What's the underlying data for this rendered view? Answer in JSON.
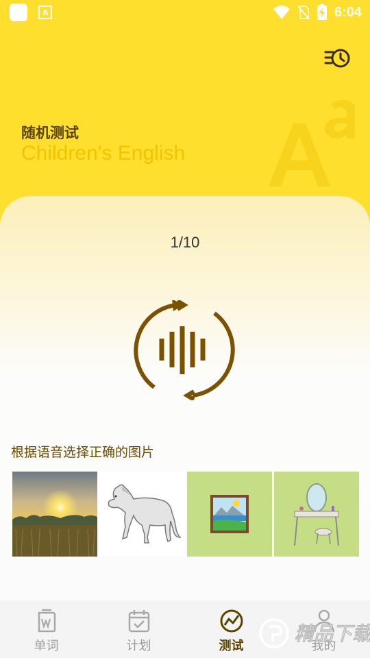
{
  "status_bar": {
    "time": "6:04",
    "icons": [
      "app-icon",
      "a-notification-icon",
      "wifi-icon",
      "no-sim-icon",
      "battery-charging-icon"
    ]
  },
  "header": {
    "title_cn": "随机测试",
    "title_en": "Children's English",
    "history_icon": "history-list-icon",
    "background_color": "#ffdf2e"
  },
  "quiz": {
    "progress": "1/10",
    "audio_icon": "replay-audio-icon",
    "question": "根据语音选择正确的图片",
    "options": [
      {
        "icon": "sunset-field-image"
      },
      {
        "icon": "horse-image"
      },
      {
        "icon": "picture-image"
      },
      {
        "icon": "dressing-table-image"
      }
    ]
  },
  "tabs": [
    {
      "label": "单词",
      "icon": "word-book-icon",
      "active": false
    },
    {
      "label": "计划",
      "icon": "calendar-check-icon",
      "active": false
    },
    {
      "label": "测试",
      "icon": "test-chart-icon",
      "active": true
    },
    {
      "label": "我的",
      "icon": "person-icon",
      "active": false
    }
  ],
  "watermark": {
    "text": "精品下载"
  },
  "colors": {
    "accent_yellow": "#ffdf2e",
    "brown": "#7a5200",
    "inactive_gray": "#9a9a9a"
  }
}
